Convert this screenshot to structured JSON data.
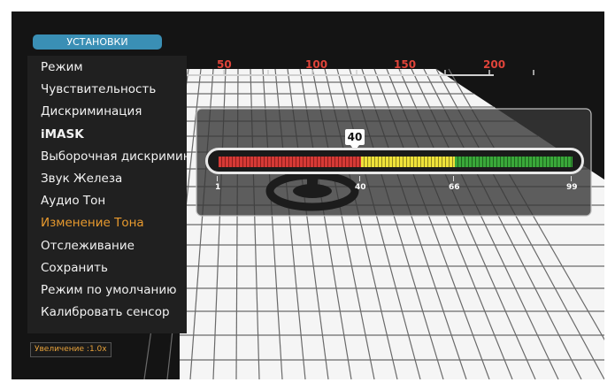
{
  "menu": {
    "header": "УСТАНОВКИ",
    "items": [
      {
        "label": "Режим",
        "style": "normal"
      },
      {
        "label": "Чувствительность",
        "style": "normal"
      },
      {
        "label": "Дискриминация",
        "style": "normal"
      },
      {
        "label": "iMASK",
        "style": "bold"
      },
      {
        "label": "Выборочная дискриминация",
        "style": "normal"
      },
      {
        "label": "Звук Железа",
        "style": "normal"
      },
      {
        "label": "Аудио Тон",
        "style": "normal"
      },
      {
        "label": "Изменение Тона",
        "style": "active"
      },
      {
        "label": "Отслеживание",
        "style": "normal"
      },
      {
        "label": "Сохранить",
        "style": "normal"
      },
      {
        "label": "Режим по умолчанию",
        "style": "normal"
      },
      {
        "label": "Калибровать сенсор",
        "style": "normal"
      }
    ]
  },
  "ruler": {
    "labels": [
      "50",
      "100",
      "150",
      "200"
    ]
  },
  "tone_bar": {
    "current_value": "40",
    "level_fraction": 0.39,
    "scale_labels": [
      "1",
      "40",
      "66",
      "99"
    ],
    "segments": [
      {
        "color": "red",
        "from": 1,
        "to": 40
      },
      {
        "color": "yellow",
        "from": 40,
        "to": 66
      },
      {
        "color": "green",
        "from": 66,
        "to": 99
      }
    ]
  },
  "zoom": {
    "label": "Увеличение :1.0x"
  },
  "colors": {
    "accent_active": "#e89a2e",
    "header_bg": "#3a8fb5",
    "ruler_labels": "#e0443a",
    "bar_red": "#d63a36",
    "bar_yellow": "#efe23a",
    "bar_green": "#3aa83a"
  },
  "icons": {
    "search_coil": "coil-silhouette-icon"
  }
}
